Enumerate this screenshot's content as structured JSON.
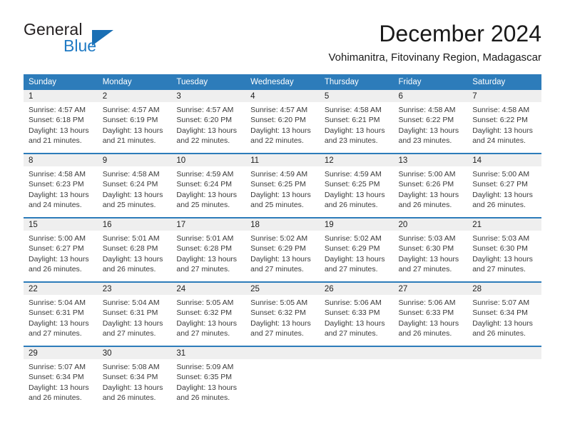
{
  "brand": {
    "name_top": "General",
    "name_bottom": "Blue",
    "accent_color": "#1a6fb4"
  },
  "header": {
    "month_title": "December 2024",
    "location": "Vohimanitra, Fitovinany Region, Madagascar"
  },
  "theme": {
    "header_blue": "#2d7cba",
    "day_band_gray": "#efefef",
    "text_color": "#222222"
  },
  "weekday_headers": [
    "Sunday",
    "Monday",
    "Tuesday",
    "Wednesday",
    "Thursday",
    "Friday",
    "Saturday"
  ],
  "labels": {
    "sunrise_prefix": "Sunrise:",
    "sunset_prefix": "Sunset:",
    "daylight_prefix": "Daylight:"
  },
  "weeks": [
    [
      {
        "day": "1",
        "sunrise": "Sunrise: 4:57 AM",
        "sunset": "Sunset: 6:18 PM",
        "daylight": "Daylight: 13 hours and 21 minutes."
      },
      {
        "day": "2",
        "sunrise": "Sunrise: 4:57 AM",
        "sunset": "Sunset: 6:19 PM",
        "daylight": "Daylight: 13 hours and 21 minutes."
      },
      {
        "day": "3",
        "sunrise": "Sunrise: 4:57 AM",
        "sunset": "Sunset: 6:20 PM",
        "daylight": "Daylight: 13 hours and 22 minutes."
      },
      {
        "day": "4",
        "sunrise": "Sunrise: 4:57 AM",
        "sunset": "Sunset: 6:20 PM",
        "daylight": "Daylight: 13 hours and 22 minutes."
      },
      {
        "day": "5",
        "sunrise": "Sunrise: 4:58 AM",
        "sunset": "Sunset: 6:21 PM",
        "daylight": "Daylight: 13 hours and 23 minutes."
      },
      {
        "day": "6",
        "sunrise": "Sunrise: 4:58 AM",
        "sunset": "Sunset: 6:22 PM",
        "daylight": "Daylight: 13 hours and 23 minutes."
      },
      {
        "day": "7",
        "sunrise": "Sunrise: 4:58 AM",
        "sunset": "Sunset: 6:22 PM",
        "daylight": "Daylight: 13 hours and 24 minutes."
      }
    ],
    [
      {
        "day": "8",
        "sunrise": "Sunrise: 4:58 AM",
        "sunset": "Sunset: 6:23 PM",
        "daylight": "Daylight: 13 hours and 24 minutes."
      },
      {
        "day": "9",
        "sunrise": "Sunrise: 4:58 AM",
        "sunset": "Sunset: 6:24 PM",
        "daylight": "Daylight: 13 hours and 25 minutes."
      },
      {
        "day": "10",
        "sunrise": "Sunrise: 4:59 AM",
        "sunset": "Sunset: 6:24 PM",
        "daylight": "Daylight: 13 hours and 25 minutes."
      },
      {
        "day": "11",
        "sunrise": "Sunrise: 4:59 AM",
        "sunset": "Sunset: 6:25 PM",
        "daylight": "Daylight: 13 hours and 25 minutes."
      },
      {
        "day": "12",
        "sunrise": "Sunrise: 4:59 AM",
        "sunset": "Sunset: 6:25 PM",
        "daylight": "Daylight: 13 hours and 26 minutes."
      },
      {
        "day": "13",
        "sunrise": "Sunrise: 5:00 AM",
        "sunset": "Sunset: 6:26 PM",
        "daylight": "Daylight: 13 hours and 26 minutes."
      },
      {
        "day": "14",
        "sunrise": "Sunrise: 5:00 AM",
        "sunset": "Sunset: 6:27 PM",
        "daylight": "Daylight: 13 hours and 26 minutes."
      }
    ],
    [
      {
        "day": "15",
        "sunrise": "Sunrise: 5:00 AM",
        "sunset": "Sunset: 6:27 PM",
        "daylight": "Daylight: 13 hours and 26 minutes."
      },
      {
        "day": "16",
        "sunrise": "Sunrise: 5:01 AM",
        "sunset": "Sunset: 6:28 PM",
        "daylight": "Daylight: 13 hours and 26 minutes."
      },
      {
        "day": "17",
        "sunrise": "Sunrise: 5:01 AM",
        "sunset": "Sunset: 6:28 PM",
        "daylight": "Daylight: 13 hours and 27 minutes."
      },
      {
        "day": "18",
        "sunrise": "Sunrise: 5:02 AM",
        "sunset": "Sunset: 6:29 PM",
        "daylight": "Daylight: 13 hours and 27 minutes."
      },
      {
        "day": "19",
        "sunrise": "Sunrise: 5:02 AM",
        "sunset": "Sunset: 6:29 PM",
        "daylight": "Daylight: 13 hours and 27 minutes."
      },
      {
        "day": "20",
        "sunrise": "Sunrise: 5:03 AM",
        "sunset": "Sunset: 6:30 PM",
        "daylight": "Daylight: 13 hours and 27 minutes."
      },
      {
        "day": "21",
        "sunrise": "Sunrise: 5:03 AM",
        "sunset": "Sunset: 6:30 PM",
        "daylight": "Daylight: 13 hours and 27 minutes."
      }
    ],
    [
      {
        "day": "22",
        "sunrise": "Sunrise: 5:04 AM",
        "sunset": "Sunset: 6:31 PM",
        "daylight": "Daylight: 13 hours and 27 minutes."
      },
      {
        "day": "23",
        "sunrise": "Sunrise: 5:04 AM",
        "sunset": "Sunset: 6:31 PM",
        "daylight": "Daylight: 13 hours and 27 minutes."
      },
      {
        "day": "24",
        "sunrise": "Sunrise: 5:05 AM",
        "sunset": "Sunset: 6:32 PM",
        "daylight": "Daylight: 13 hours and 27 minutes."
      },
      {
        "day": "25",
        "sunrise": "Sunrise: 5:05 AM",
        "sunset": "Sunset: 6:32 PM",
        "daylight": "Daylight: 13 hours and 27 minutes."
      },
      {
        "day": "26",
        "sunrise": "Sunrise: 5:06 AM",
        "sunset": "Sunset: 6:33 PM",
        "daylight": "Daylight: 13 hours and 27 minutes."
      },
      {
        "day": "27",
        "sunrise": "Sunrise: 5:06 AM",
        "sunset": "Sunset: 6:33 PM",
        "daylight": "Daylight: 13 hours and 26 minutes."
      },
      {
        "day": "28",
        "sunrise": "Sunrise: 5:07 AM",
        "sunset": "Sunset: 6:34 PM",
        "daylight": "Daylight: 13 hours and 26 minutes."
      }
    ],
    [
      {
        "day": "29",
        "sunrise": "Sunrise: 5:07 AM",
        "sunset": "Sunset: 6:34 PM",
        "daylight": "Daylight: 13 hours and 26 minutes."
      },
      {
        "day": "30",
        "sunrise": "Sunrise: 5:08 AM",
        "sunset": "Sunset: 6:34 PM",
        "daylight": "Daylight: 13 hours and 26 minutes."
      },
      {
        "day": "31",
        "sunrise": "Sunrise: 5:09 AM",
        "sunset": "Sunset: 6:35 PM",
        "daylight": "Daylight: 13 hours and 26 minutes."
      },
      {
        "day": "",
        "sunrise": "",
        "sunset": "",
        "daylight": ""
      },
      {
        "day": "",
        "sunrise": "",
        "sunset": "",
        "daylight": ""
      },
      {
        "day": "",
        "sunrise": "",
        "sunset": "",
        "daylight": ""
      },
      {
        "day": "",
        "sunrise": "",
        "sunset": "",
        "daylight": ""
      }
    ]
  ]
}
